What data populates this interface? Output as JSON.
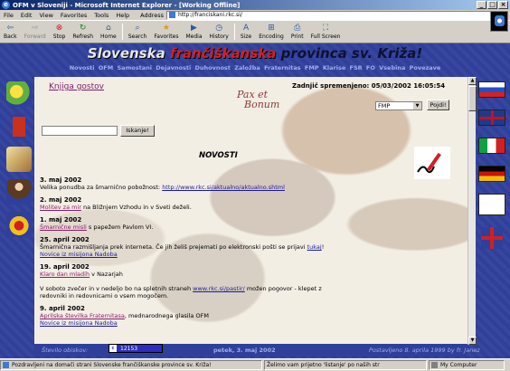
{
  "window": {
    "title": "OFM v Sloveniji - Microsoft Internet Explorer - [Working Offline]",
    "minimize": "_",
    "maximize": "□",
    "close": "×"
  },
  "menu": [
    "File",
    "Edit",
    "View",
    "Favorites",
    "Tools",
    "Help"
  ],
  "address": {
    "label": "Address",
    "value": "http://franciskani.rkc.si/"
  },
  "toolbar": [
    {
      "label": "Back",
      "icon": "back-arrow-icon",
      "enabled": true
    },
    {
      "label": "Forward",
      "icon": "forward-arrow-icon",
      "enabled": false
    },
    {
      "label": "Stop",
      "icon": "stop-icon",
      "enabled": true
    },
    {
      "label": "Refresh",
      "icon": "refresh-icon",
      "enabled": true
    },
    {
      "label": "Home",
      "icon": "home-icon",
      "enabled": true
    },
    {
      "label": "Search",
      "icon": "search-icon",
      "enabled": true
    },
    {
      "label": "Favorites",
      "icon": "favorites-icon",
      "enabled": true
    },
    {
      "label": "Media",
      "icon": "media-icon",
      "enabled": true
    },
    {
      "label": "History",
      "icon": "history-icon",
      "enabled": true
    },
    {
      "label": "Size",
      "icon": "size-icon",
      "enabled": true
    },
    {
      "label": "Encoding",
      "icon": "encoding-icon",
      "enabled": true
    },
    {
      "label": "Print",
      "icon": "print-icon",
      "enabled": true
    },
    {
      "label": "Full Screen",
      "icon": "fullscreen-icon",
      "enabled": true
    }
  ],
  "site": {
    "title_part1": "Slovenska",
    "title_part2": " frančiškanska",
    "title_part3": " provinca sv. Križa!",
    "nav": [
      "Novosti",
      "OFM",
      "Samostani",
      "Dejavnosti",
      "Duhovnost",
      "Založba",
      "Fraternitas",
      "FMP",
      "Klarise",
      "FSR",
      "FO",
      "Vsebina",
      "Povezave"
    ]
  },
  "content": {
    "guestbook": "Knjiga gostov",
    "pax_line1": "Pax et",
    "pax_line2": "Bonum",
    "updated": "Zadnjič spremenjeno: 05/03/2002 16:05:54",
    "select_value": "FMP",
    "go_button": "Pojdi!",
    "search_button": "Iskanje!",
    "heading": "NOVOSTI"
  },
  "news": [
    {
      "date": "3. maj 2002",
      "text": "Velika ponudba za šmarnično pobožnost: ",
      "link": "http://www.rkc.si/aktualno/aktualno.shtml",
      "after": ""
    },
    {
      "date": "2. maj 2002",
      "link": "Molitev za mir",
      "text": " na Bližnjem Vzhodu in v Sveti deželi."
    },
    {
      "date": "1. maj 2002",
      "link": "Šmarnične misli",
      "text": " s papežem Pavlom VI."
    },
    {
      "date": "25. april 2002",
      "text": "Šmarnična razmišljanja prek interneta. Če jih želiš prejemati po elektronski pošti se prijavi ",
      "link": "tukaj",
      "after": "!",
      "link2": "Novice iz misijona Nadoba"
    },
    {
      "date": "19. april 2002",
      "link": "Klaro dan mladih",
      "text": " v Nazarjah",
      "text2": "V soboto zvečer in v nedeljo bo na spletnih straneh ",
      "link2": "www.rkc.si/pastir/",
      "after2": " možen pogovor - klepet z redovniki in redovnicami o vsem mogočem."
    },
    {
      "date": "9. april 2002",
      "link": "Aprilska številka Fraternitasa",
      "text": ", mednarodnega glasila OFM",
      "link2": "Novice iz misijona Nadoba"
    }
  ],
  "footer": {
    "visitors_label": "Število obiskov:",
    "counter_value": "12153",
    "date": "petek, 3. maj 2002",
    "posted": "Postavljeno 8. aprila 1999 by fr. Janez"
  },
  "status": {
    "left": "Pozdravljeni na domači strani Slovenske frančiškanske province sv. Križa!",
    "mid": "Želimo vam prijetno 'listanje' po naših str",
    "right": "My Computer"
  },
  "colors": {
    "page_bg": "#2f3f9a",
    "title_red": "#d42020",
    "link": "#1a1a9a",
    "visited": "#8a1a6a"
  }
}
